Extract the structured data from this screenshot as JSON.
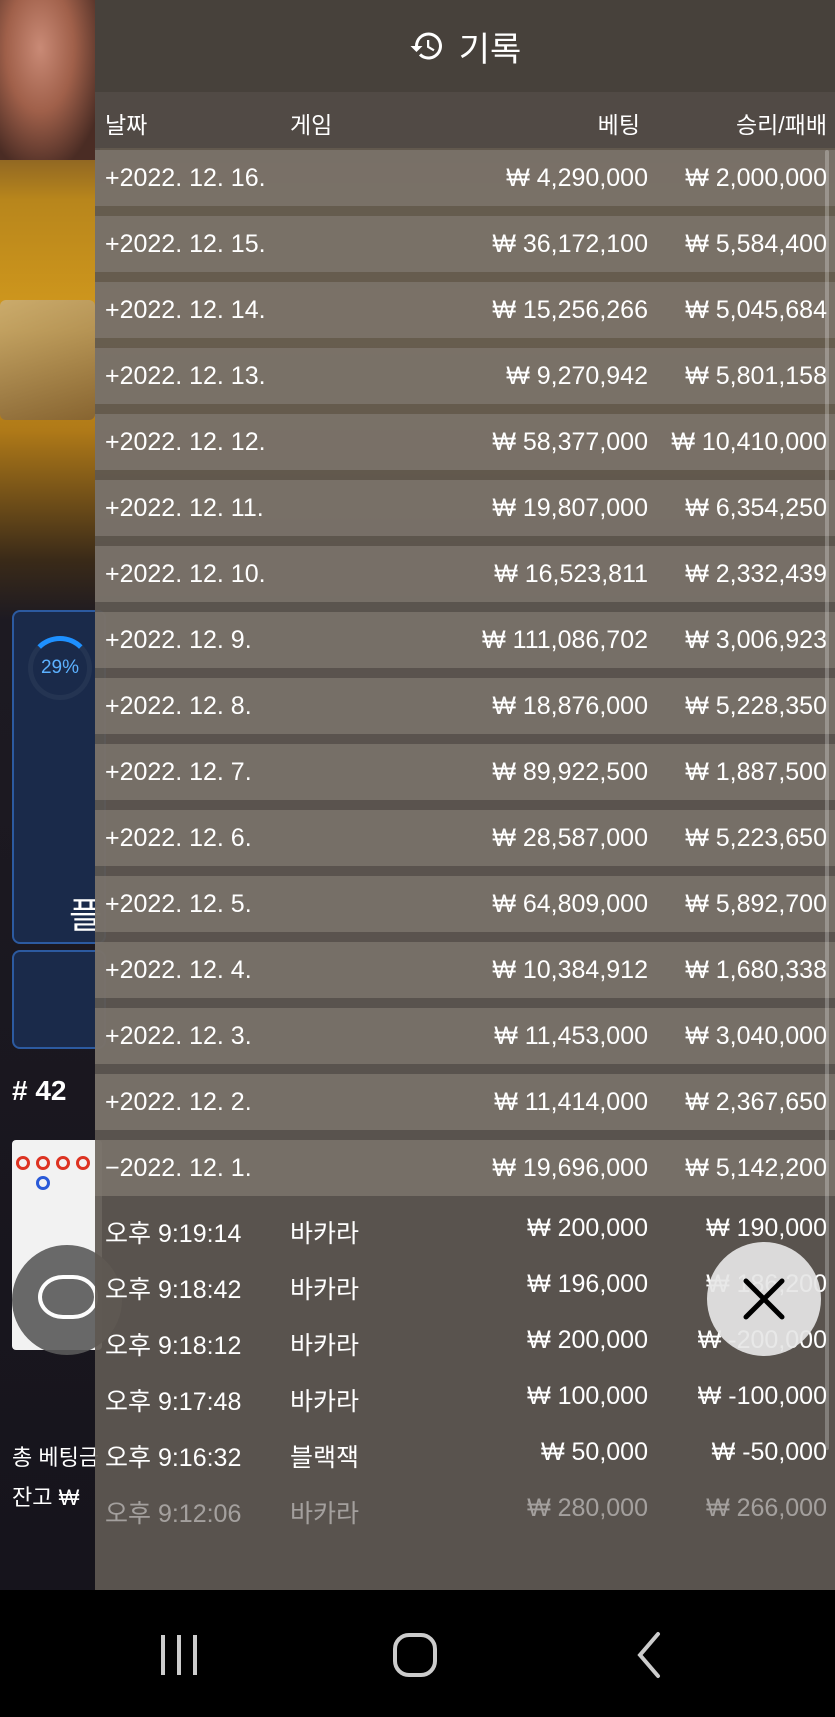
{
  "panel": {
    "title": "기록",
    "icon": "history-icon",
    "columns": {
      "date": "날짜",
      "game": "게임",
      "bet": "베팅",
      "result": "승리/패배"
    },
    "day_rows": [
      {
        "date": "+2022. 12. 16.",
        "bet": "₩ 4,290,000",
        "result": "₩ 2,000,000"
      },
      {
        "date": "+2022. 12. 15.",
        "bet": "₩ 36,172,100",
        "result": "₩ 5,584,400"
      },
      {
        "date": "+2022. 12. 14.",
        "bet": "₩ 15,256,266",
        "result": "₩ 5,045,684"
      },
      {
        "date": "+2022. 12. 13.",
        "bet": "₩ 9,270,942",
        "result": "₩ 5,801,158"
      },
      {
        "date": "+2022. 12. 12.",
        "bet": "₩ 58,377,000",
        "result": "₩ 10,410,000"
      },
      {
        "date": "+2022. 12. 11.",
        "bet": "₩ 19,807,000",
        "result": "₩ 6,354,250"
      },
      {
        "date": "+2022. 12. 10.",
        "bet": "₩ 16,523,811",
        "result": "₩ 2,332,439"
      },
      {
        "date": "+2022. 12. 9.",
        "bet": "₩ 111,086,702",
        "result": "₩ 3,006,923"
      },
      {
        "date": "+2022. 12. 8.",
        "bet": "₩ 18,876,000",
        "result": "₩ 5,228,350"
      },
      {
        "date": "+2022. 12. 7.",
        "bet": "₩ 89,922,500",
        "result": "₩ 1,887,500"
      },
      {
        "date": "+2022. 12. 6.",
        "bet": "₩ 28,587,000",
        "result": "₩ 5,223,650"
      },
      {
        "date": "+2022. 12. 5.",
        "bet": "₩ 64,809,000",
        "result": "₩ 5,892,700"
      },
      {
        "date": "+2022. 12. 4.",
        "bet": "₩ 10,384,912",
        "result": "₩ 1,680,338"
      },
      {
        "date": "+2022. 12. 3.",
        "bet": "₩ 11,453,000",
        "result": "₩ 3,040,000"
      },
      {
        "date": "+2022. 12. 2.",
        "bet": "₩ 11,414,000",
        "result": "₩ 2,367,650"
      },
      {
        "date": "−2022. 12. 1.",
        "bet": "₩ 19,696,000",
        "result": "₩ 5,142,200"
      }
    ],
    "detail_rows": [
      {
        "time": "오후 9:19:14",
        "game": "바카라",
        "bet": "₩ 200,000",
        "result": "₩ 190,000"
      },
      {
        "time": "오후 9:18:42",
        "game": "바카라",
        "bet": "₩ 196,000",
        "result": "₩ 186,200"
      },
      {
        "time": "오후 9:18:12",
        "game": "바카라",
        "bet": "₩ 200,000",
        "result": "₩ -200,000"
      },
      {
        "time": "오후 9:17:48",
        "game": "바카라",
        "bet": "₩ 100,000",
        "result": "₩ -100,000"
      },
      {
        "time": "오후 9:16:32",
        "game": "블랙잭",
        "bet": "₩ 50,000",
        "result": "₩ -50,000"
      },
      {
        "time": "오후 9:12:06",
        "game": "바카라",
        "bet": "₩ 280,000",
        "result": "₩ 266,000"
      }
    ],
    "close_icon": "close-icon"
  },
  "background": {
    "progress_percent": "29%",
    "side_glyph": "플",
    "round_label": "# 42",
    "total_bet_label": "총 베팅금",
    "balance_label": "잔고 ₩"
  },
  "navbar": {
    "recent_icon": "recent-apps-icon",
    "home_icon": "home-icon",
    "back_icon": "back-icon"
  },
  "colors": {
    "accent_blue": "#1e90ff",
    "panel_bg": "#5f5852",
    "row_bg": "#807870"
  }
}
